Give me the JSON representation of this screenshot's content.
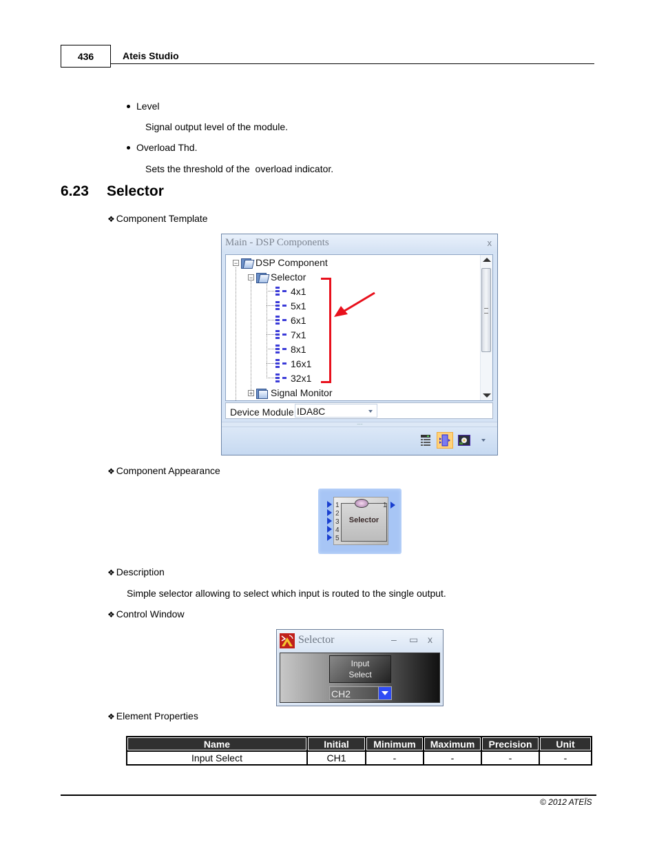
{
  "header": {
    "page_number": "436",
    "title": "Ateis Studio"
  },
  "intro_bullets": [
    {
      "label": "Level",
      "description": "Signal output level of the module."
    },
    {
      "label": "Overload Thd.",
      "description": "Sets the threshold of the  overload indicator."
    }
  ],
  "section": {
    "number": "6.23",
    "title": "Selector"
  },
  "subheadings": {
    "bullet_glyph": "❖",
    "component_template": "Component Template",
    "component_appearance": "Component Appearance",
    "description": "Description",
    "control_window": "Control Window",
    "element_properties": "Element Properties"
  },
  "description_text": "Simple selector allowing to select which input is routed to the single output.",
  "dsp_window": {
    "title": "Main - DSP Components",
    "close_glyph": "x",
    "tree": {
      "root": {
        "label": "DSP Component",
        "expander": "−",
        "icon": "folder-open-icon"
      },
      "selector": {
        "label": "Selector",
        "expander": "−",
        "icon": "folder-open-icon"
      },
      "children": [
        "4x1",
        "5x1",
        "6x1",
        "7x1",
        "8x1",
        "16x1",
        "32x1"
      ],
      "child_icon": "selector-component-icon",
      "signal_monitor": {
        "label": "Signal Monitor",
        "expander": "+",
        "icon": "folder-closed-icon"
      }
    },
    "annotation_color": "#e8101c",
    "device_module": {
      "label": "Device Module",
      "value": "IDA8C"
    },
    "splitter_glyph": "·····",
    "toolbar": [
      {
        "name": "list-view-icon",
        "active": false
      },
      {
        "name": "component-view-icon",
        "active": true
      },
      {
        "name": "image-view-icon",
        "active": false
      },
      {
        "name": "toolbar-overflow-icon",
        "active": false
      }
    ]
  },
  "component_appearance": {
    "label": "Selector",
    "inputs": [
      "1",
      "2",
      "3",
      "4",
      "5"
    ],
    "outputs": [
      "1"
    ],
    "background_color": "#a7c5f5"
  },
  "control_window": {
    "title": "Selector",
    "minimize_glyph": "–",
    "maximize_glyph": "▭",
    "close_glyph": "x",
    "button_label_line1": "Input",
    "button_label_line2": "Select",
    "select_value": "CH2"
  },
  "properties_table": {
    "headers": [
      "Name",
      "Initial",
      "Minimum",
      "Maximum",
      "Precision",
      "Unit"
    ],
    "rows": [
      [
        "Input Select",
        "CH1",
        "-",
        "-",
        "-",
        "-"
      ]
    ]
  },
  "footer": {
    "copyright": "© 2012 ATEÏS"
  }
}
